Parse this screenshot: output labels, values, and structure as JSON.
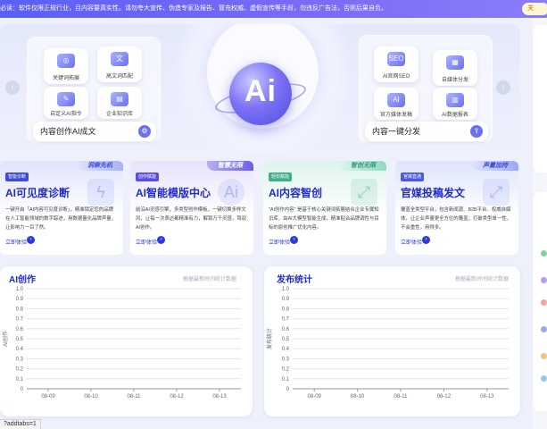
{
  "notice": {
    "text": "必读：软件仅限正规行业，且内容要真实性。请勿夸大宣传、伪造专家及报告、冒充权威、虚假宣传等手段，勿违反广告法，否则后果自负。",
    "button": "关"
  },
  "hero": {
    "center_label": "Ai",
    "left_panel": {
      "title": "内容创作AI成文",
      "tiles": [
        "关键词拓展",
        "高文词匹配",
        "自定义AI指令",
        "企业知识库"
      ]
    },
    "right_panel": {
      "title": "内容一键分发",
      "tiles": [
        "AI官网SEO",
        "自媒体分发",
        "官方媒体发稿",
        "AI数据报表"
      ]
    },
    "prev_arrow": "‹",
    "next_arrow": "›"
  },
  "features": [
    {
      "tag": "智能诊断",
      "badge": "洞察先机",
      "title": "AI可见度诊断",
      "desc": "一键开启「AI内容可见度诊断」，精准锁定您的品牌在人工智能领域的数字踪迹，用数据量化品牌声量，让影响力一目了然。",
      "link": "立即体验",
      "color": "#3f4bd8"
    },
    {
      "tag": "创作赋能",
      "badge": "智慧无限",
      "title": "AI智能模版中心",
      "desc": "前沿AI灵感引擎，多类型创作模板，一键切换多样文风，让每一次表达都精准有力，解锁万千灵感，驾驭AI创作。",
      "link": "立即体验",
      "color": "#5a4fe0"
    },
    {
      "tag": "轻松赋能",
      "badge": "智创无限",
      "title": "AI内容智创",
      "desc": "\"AI创作内容\" 是基于核心关键词拓展结合企业专属知识库，由AI大模型智能生成，精准贴合品牌调性与目标的原创推广优化内容。",
      "link": "立即体验",
      "color": "#3fae8a"
    },
    {
      "tag": "官媒直通",
      "badge": "声量加持",
      "title": "官媒投稿发文",
      "desc": "覆盖全类型平台，包含新闻源、B2B平台、权威自媒体，让企业声量更全方位的覆盖；打破类型单一性，不会重性，用得多。",
      "link": "立即体验",
      "color": "#4b58e0"
    }
  ],
  "charts": [
    {
      "title": "AI创作",
      "note": "根据最新时间统计数据",
      "ylabel": "AI创作",
      "chart_data": {
        "type": "line",
        "x": [
          "08-09",
          "08-10",
          "08-11",
          "08-12",
          "08-13"
        ],
        "series": [],
        "yticks": [
          "0",
          "0.1",
          "0.2",
          "0.3",
          "0.4",
          "0.5",
          "0.6",
          "0.7",
          "0.8",
          "0.9",
          "1.0"
        ],
        "ylim": [
          0,
          1
        ],
        "grid": true
      }
    },
    {
      "title": "发布统计",
      "note": "根据最新时间统计数据",
      "ylabel": "发布统计",
      "chart_data": {
        "type": "line",
        "x": [
          "08-09",
          "08-10",
          "08-11",
          "08-12",
          "08-13"
        ],
        "series": [],
        "yticks": [
          "0",
          "0.1",
          "0.2",
          "0.3",
          "0.4",
          "0.5",
          "0.6",
          "0.7",
          "0.8",
          "0.9",
          "1.0"
        ],
        "ylim": [
          0,
          1
        ],
        "grid": true
      }
    }
  ],
  "status_url": "?addtabs=1"
}
